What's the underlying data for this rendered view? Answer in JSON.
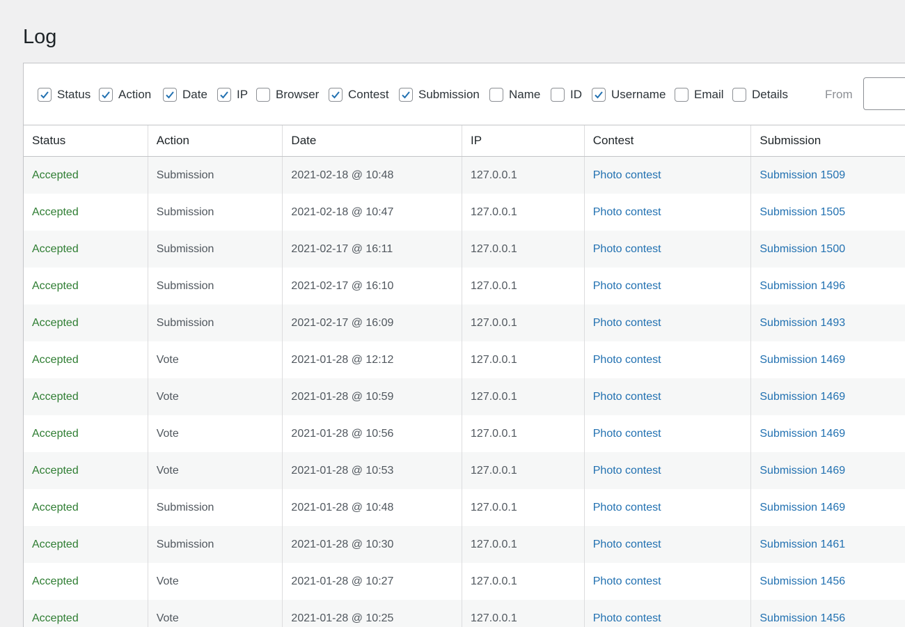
{
  "page": {
    "title": "Log"
  },
  "filters": [
    {
      "label": "Status",
      "checked": true
    },
    {
      "label": "Action",
      "checked": true
    },
    {
      "label": "Date",
      "checked": true
    },
    {
      "label": "IP",
      "checked": true
    },
    {
      "label": "Browser",
      "checked": false
    },
    {
      "label": "Contest",
      "checked": true
    },
    {
      "label": "Submission",
      "checked": true
    },
    {
      "label": "Name",
      "checked": false
    },
    {
      "label": "ID",
      "checked": false
    },
    {
      "label": "Username",
      "checked": true
    },
    {
      "label": "Email",
      "checked": false
    },
    {
      "label": "Details",
      "checked": false
    }
  ],
  "from": {
    "label": "From",
    "value": ""
  },
  "table": {
    "columns": [
      "Status",
      "Action",
      "Date",
      "IP",
      "Contest",
      "Submission"
    ],
    "rows": [
      {
        "status": "Accepted",
        "action": "Submission",
        "date": "2021-02-18 @ 10:48",
        "ip": "127.0.0.1",
        "contest": "Photo contest",
        "submission": "Submission 1509"
      },
      {
        "status": "Accepted",
        "action": "Submission",
        "date": "2021-02-18 @ 10:47",
        "ip": "127.0.0.1",
        "contest": "Photo contest",
        "submission": "Submission 1505"
      },
      {
        "status": "Accepted",
        "action": "Submission",
        "date": "2021-02-17 @ 16:11",
        "ip": "127.0.0.1",
        "contest": "Photo contest",
        "submission": "Submission 1500"
      },
      {
        "status": "Accepted",
        "action": "Submission",
        "date": "2021-02-17 @ 16:10",
        "ip": "127.0.0.1",
        "contest": "Photo contest",
        "submission": "Submission 1496"
      },
      {
        "status": "Accepted",
        "action": "Submission",
        "date": "2021-02-17 @ 16:09",
        "ip": "127.0.0.1",
        "contest": "Photo contest",
        "submission": "Submission 1493"
      },
      {
        "status": "Accepted",
        "action": "Vote",
        "date": "2021-01-28 @ 12:12",
        "ip": "127.0.0.1",
        "contest": "Photo contest",
        "submission": "Submission 1469"
      },
      {
        "status": "Accepted",
        "action": "Vote",
        "date": "2021-01-28 @ 10:59",
        "ip": "127.0.0.1",
        "contest": "Photo contest",
        "submission": "Submission 1469"
      },
      {
        "status": "Accepted",
        "action": "Vote",
        "date": "2021-01-28 @ 10:56",
        "ip": "127.0.0.1",
        "contest": "Photo contest",
        "submission": "Submission 1469"
      },
      {
        "status": "Accepted",
        "action": "Vote",
        "date": "2021-01-28 @ 10:53",
        "ip": "127.0.0.1",
        "contest": "Photo contest",
        "submission": "Submission 1469"
      },
      {
        "status": "Accepted",
        "action": "Submission",
        "date": "2021-01-28 @ 10:48",
        "ip": "127.0.0.1",
        "contest": "Photo contest",
        "submission": "Submission 1469"
      },
      {
        "status": "Accepted",
        "action": "Submission",
        "date": "2021-01-28 @ 10:30",
        "ip": "127.0.0.1",
        "contest": "Photo contest",
        "submission": "Submission 1461"
      },
      {
        "status": "Accepted",
        "action": "Vote",
        "date": "2021-01-28 @ 10:27",
        "ip": "127.0.0.1",
        "contest": "Photo contest",
        "submission": "Submission 1456"
      },
      {
        "status": "Accepted",
        "action": "Vote",
        "date": "2021-01-28 @ 10:25",
        "ip": "127.0.0.1",
        "contest": "Photo contest",
        "submission": "Submission 1456"
      }
    ]
  },
  "colors": {
    "accepted": "#2e7d32",
    "link": "#2271b1",
    "checkbox": "#2271b1"
  },
  "icons": {
    "checkbox_check": "checkmark-icon"
  }
}
